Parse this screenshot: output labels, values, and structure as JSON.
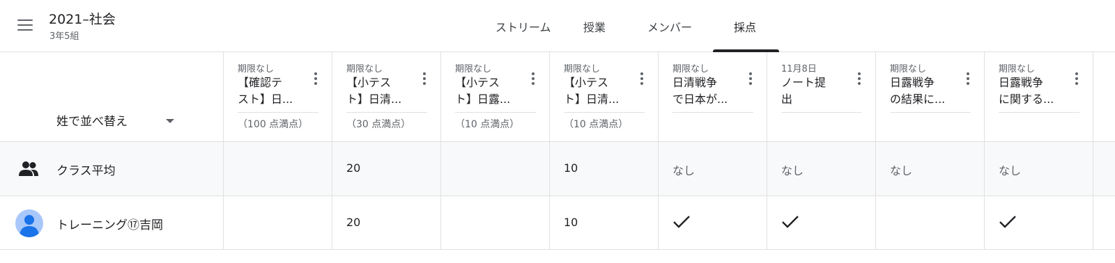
{
  "header": {
    "title": "2021–社会",
    "subtitle": "3年5組",
    "tabs": [
      {
        "label": "ストリーム",
        "active": false
      },
      {
        "label": "授業",
        "active": false
      },
      {
        "label": "メンバー",
        "active": false
      },
      {
        "label": "採点",
        "active": true
      }
    ]
  },
  "sort": {
    "label": "姓で並べ替え"
  },
  "assignments": [
    {
      "due": "期限なし",
      "title_line1": "【確認テ",
      "title_line2": "スト】日...",
      "points": "（100 点満点）"
    },
    {
      "due": "期限なし",
      "title_line1": "【小テス",
      "title_line2": "ト】日清...",
      "points": "（30 点満点）"
    },
    {
      "due": "期限なし",
      "title_line1": "【小テス",
      "title_line2": "ト】日露...",
      "points": "（10 点満点）"
    },
    {
      "due": "期限なし",
      "title_line1": "【小テス",
      "title_line2": "ト】日清...",
      "points": "（10 点満点）"
    },
    {
      "due": "期限なし",
      "title_line1": "日清戦争",
      "title_line2": "で日本が...",
      "points": ""
    },
    {
      "due": "11月8日",
      "title_line1": "ノート提",
      "title_line2": "出",
      "points": ""
    },
    {
      "due": "期限なし",
      "title_line1": "日露戦争",
      "title_line2": "の結果に...",
      "points": ""
    },
    {
      "due": "期限なし",
      "title_line1": "日露戦争",
      "title_line2": "に関する...",
      "points": ""
    }
  ],
  "class_average": {
    "label": "クラス平均",
    "values": [
      "",
      "20",
      "",
      "10",
      "なし",
      "なし",
      "なし",
      "なし"
    ]
  },
  "students": [
    {
      "name": "トレーニング⑰吉岡",
      "grades": [
        "",
        "20",
        "",
        "10",
        "check",
        "check",
        "",
        "check"
      ]
    }
  ],
  "colors": {
    "accent": "#202124",
    "avg_row_bg": "#f8f9fa",
    "avatar_bg": "#a8c7fa",
    "avatar_fg": "#1a73e8"
  }
}
